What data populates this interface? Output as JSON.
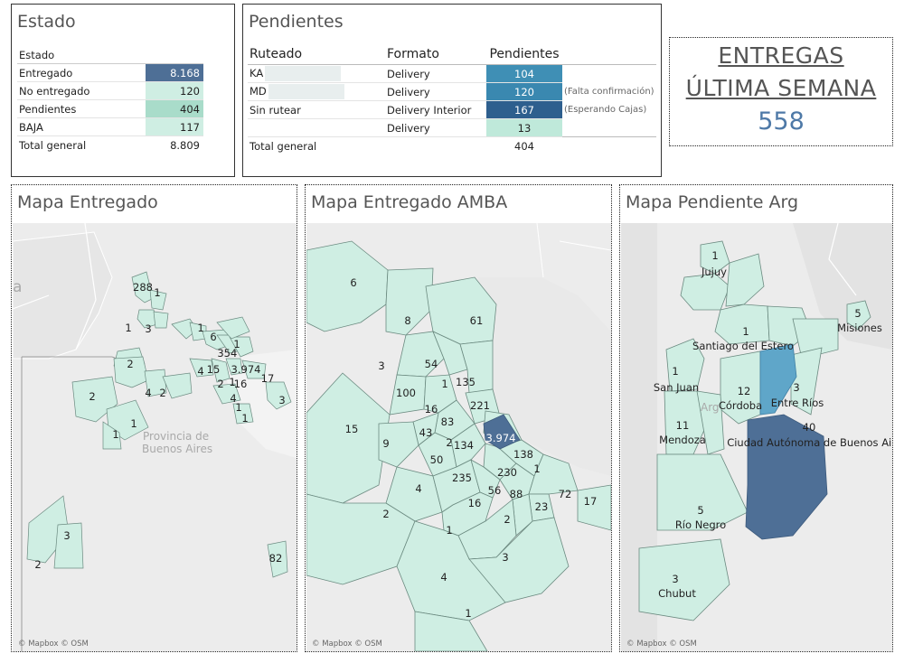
{
  "estado": {
    "title": "Estado",
    "header": "Estado",
    "rows": [
      {
        "label": "Entregado",
        "value": "8.168",
        "color": "#4e6f96",
        "text_color": "#ffffff"
      },
      {
        "label": "No entregado",
        "value": "120",
        "color": "#cfeee3",
        "text_color": "#222222"
      },
      {
        "label": "Pendientes",
        "value": "404",
        "color": "#a9dcca",
        "text_color": "#222222"
      },
      {
        "label": "BAJA",
        "value": "117",
        "color": "#cfeee3",
        "text_color": "#222222"
      }
    ],
    "total_label": "Total general",
    "total_value": "8.809"
  },
  "pendientes": {
    "title": "Pendientes",
    "headers": {
      "ruteado": "Ruteado",
      "formato": "Formato",
      "pendientes": "Pendientes"
    },
    "rows": [
      {
        "ruteado": "KA",
        "formato": "Delivery",
        "value": "104",
        "note": "",
        "color": "#3f8fb5",
        "text_color": "#ffffff"
      },
      {
        "ruteado": "MD",
        "formato": "Delivery",
        "value": "120",
        "note": "(Falta confirmación)",
        "color": "#3a88b0",
        "text_color": "#ffffff"
      },
      {
        "ruteado": "Sin rutear",
        "formato": "Delivery Interior",
        "value": "167",
        "note": "(Esperando Cajas)",
        "color": "#2e5f8e",
        "text_color": "#ffffff"
      },
      {
        "ruteado": "",
        "formato": "Delivery",
        "value": "13",
        "note": "",
        "color": "#bfe9da",
        "text_color": "#222222"
      }
    ],
    "total_label": "Total general",
    "total_value": "404"
  },
  "kpi": {
    "line1": "ENTREGAS",
    "line2": "ÚLTIMA SEMANA",
    "value": "558"
  },
  "map1": {
    "title": "Mapa Entregado",
    "region_label_1": "Provincia de",
    "region_label_2": "Buenos Aires",
    "edge_letter": "a",
    "credit": "© Mapbox © OSM",
    "labels": [
      "288",
      "1",
      "1",
      "3",
      "1",
      "6",
      "3",
      "54",
      "1",
      "2",
      "4",
      "15",
      "3.974",
      "17",
      "2",
      "16",
      "1",
      "4",
      "1",
      "3",
      "1",
      "4",
      "2",
      "2",
      "1",
      "1",
      "3",
      "2",
      "82"
    ]
  },
  "map2": {
    "title": "Mapa Entregado AMBA",
    "credit": "© Mapbox © OSM",
    "labels": [
      "6",
      "8",
      "61",
      "3",
      "54",
      "135",
      "100",
      "1",
      "221",
      "16",
      "83",
      "15",
      "43",
      "3.974",
      "9",
      "2",
      "134",
      "138",
      "50",
      "235",
      "230",
      "1",
      "4",
      "56",
      "88",
      "72",
      "17",
      "16",
      "23",
      "2",
      "2",
      "1",
      "3",
      "4",
      "1"
    ]
  },
  "map3": {
    "title": "Mapa Pendiente Arg",
    "credit": "© Mapbox © OSM",
    "labels": [
      {
        "n": "1",
        "name": "Jujuy"
      },
      {
        "n": "5",
        "name": "Misiones"
      },
      {
        "n": "1",
        "name": "Santiago del Estero"
      },
      {
        "n": "1",
        "name": "San Juan"
      },
      {
        "n": "12",
        "name": "Córdoba"
      },
      {
        "n": "3",
        "name": "Entre Ríos"
      },
      {
        "n": "11",
        "name": "Mendoza"
      },
      {
        "n": "40",
        "name": "Ciudad Autónoma de Buenos Aire"
      },
      {
        "n": "5",
        "name": "Río Negro"
      },
      {
        "n": "3",
        "name": "Chubut"
      }
    ],
    "faint_label": "Arg"
  },
  "colors": {
    "map_fill": "#cfeee3",
    "map_stroke": "#6b8a80",
    "caba_dark": "#4e6f96",
    "santa_fe": "#5fa6c9",
    "background_map": "#ececec"
  }
}
